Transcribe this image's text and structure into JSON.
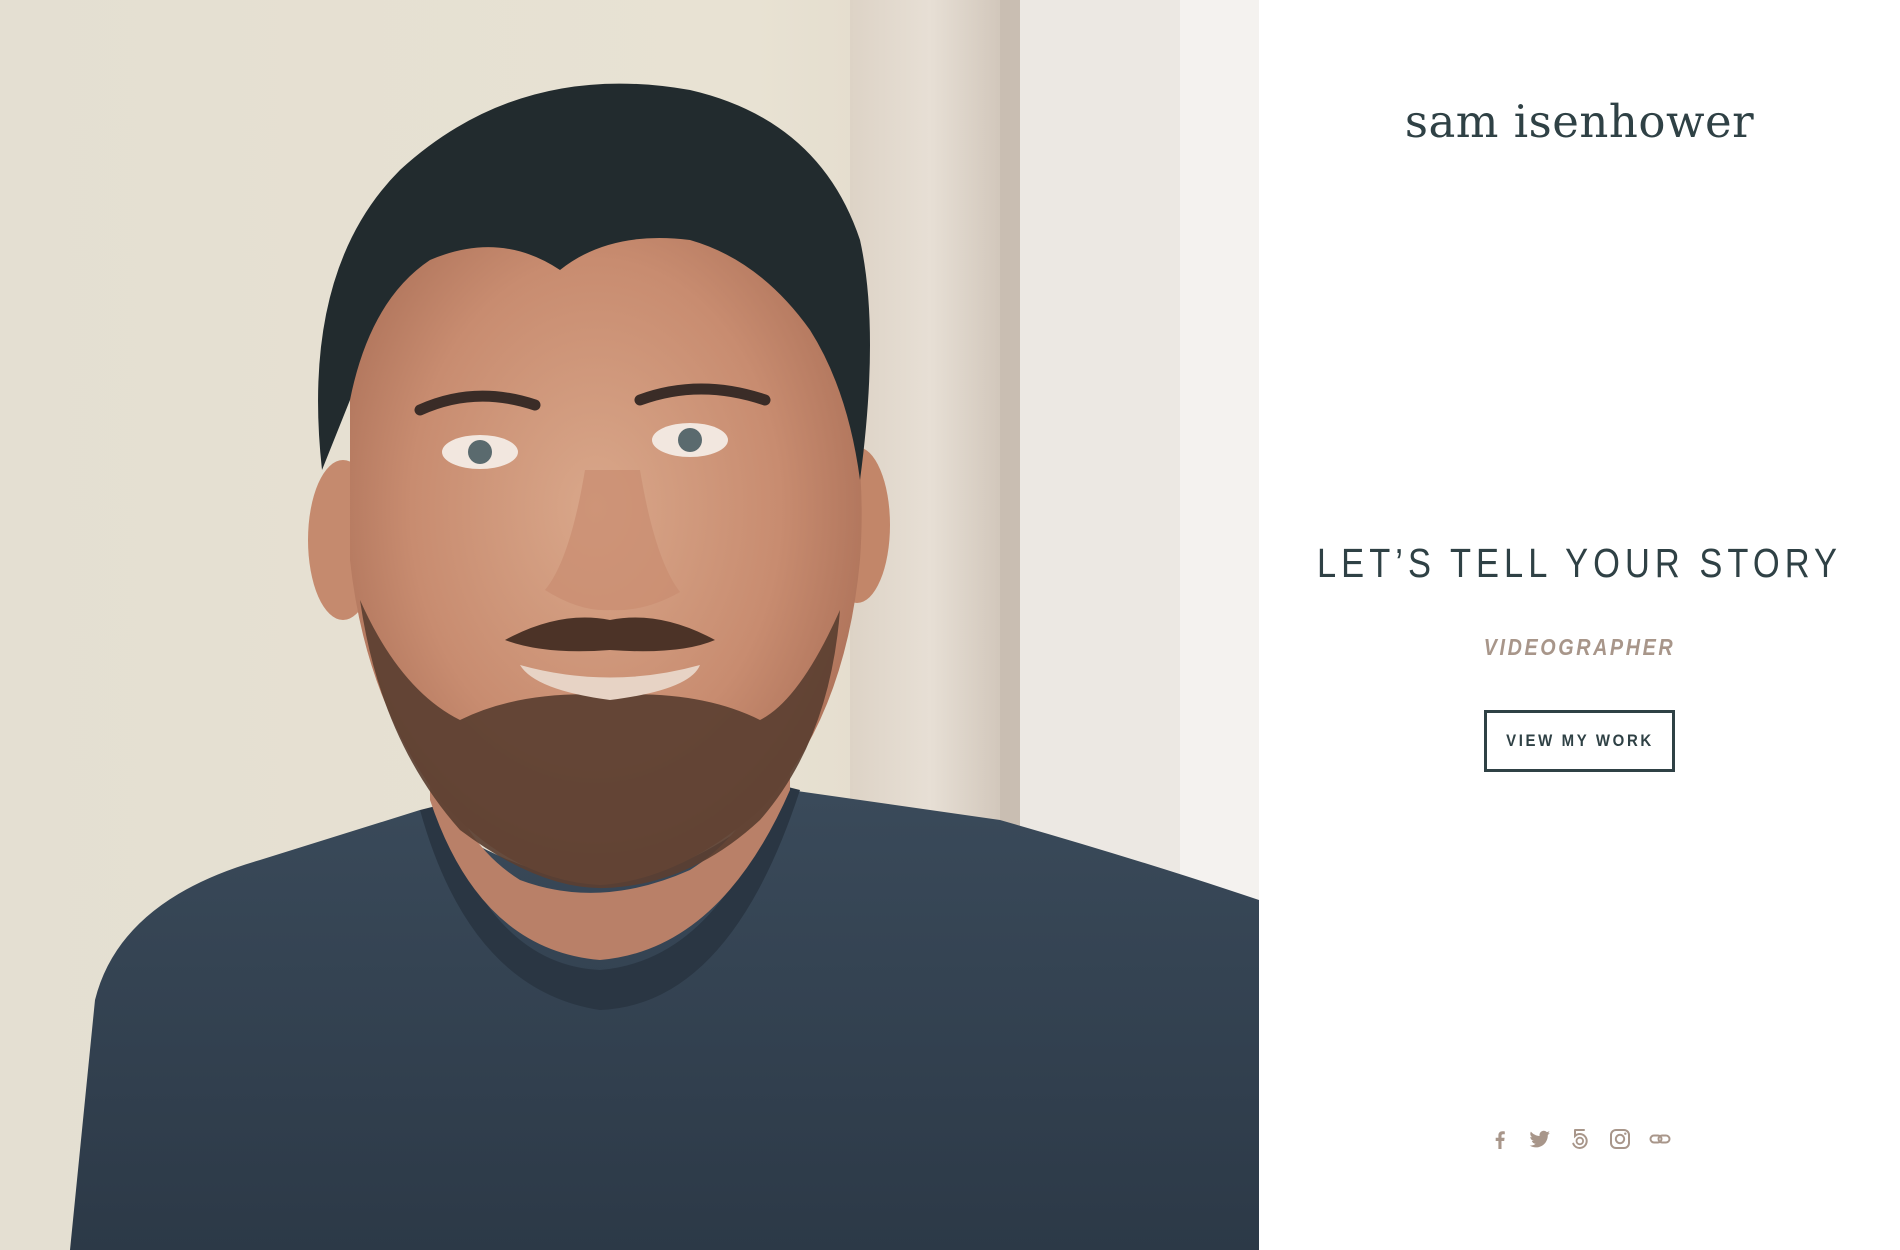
{
  "theme": {
    "primary": "#2f4145",
    "accent": "#a8968a",
    "background": "#ffffff"
  },
  "site": {
    "logo_text": "sam isenhower"
  },
  "hero": {
    "heading": "LET’S TELL YOUR STORY",
    "subtitle": "VIDEOGRAPHER",
    "cta_label": "VIEW MY WORK"
  },
  "photo": {
    "subject": "portrait of a man with a beard in a dark t-shirt"
  },
  "social": [
    {
      "name": "facebook",
      "icon": "facebook-icon"
    },
    {
      "name": "twitter",
      "icon": "twitter-icon"
    },
    {
      "name": "500px",
      "icon": "500px-icon"
    },
    {
      "name": "instagram",
      "icon": "instagram-icon"
    },
    {
      "name": "link",
      "icon": "link-icon"
    }
  ]
}
